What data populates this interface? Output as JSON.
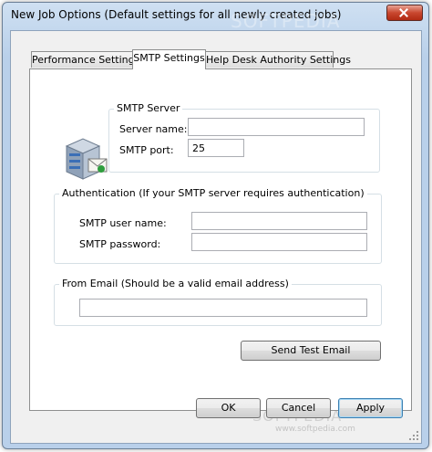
{
  "window": {
    "title": "New Job Options (Default settings for all newly created jobs)"
  },
  "watermark": {
    "top": "SOFTPEDIA",
    "bottom": "SOFTPEDIA",
    "url": "www.softpedia.com"
  },
  "tabs": [
    {
      "label": "Performance Settings",
      "active": false
    },
    {
      "label": "SMTP Settings",
      "active": true
    },
    {
      "label": "Help Desk Authority Settings",
      "active": false
    }
  ],
  "smtp_server": {
    "legend": "SMTP Server",
    "server_name_label": "Server name:",
    "server_name_value": "",
    "port_label": "SMTP port:",
    "port_value": "25"
  },
  "authentication": {
    "legend": "Authentication (If your SMTP server requires authentication)",
    "username_label": "SMTP user name:",
    "username_value": "",
    "password_label": "SMTP password:",
    "password_value": ""
  },
  "from_email": {
    "legend": "From Email (Should be a valid email address)",
    "value": ""
  },
  "buttons": {
    "send_test": "Send Test Email",
    "ok": "OK",
    "cancel": "Cancel",
    "apply": "Apply"
  },
  "icons": {
    "server": "server-icon",
    "close": "close-icon",
    "grip": "resize-grip-icon"
  }
}
